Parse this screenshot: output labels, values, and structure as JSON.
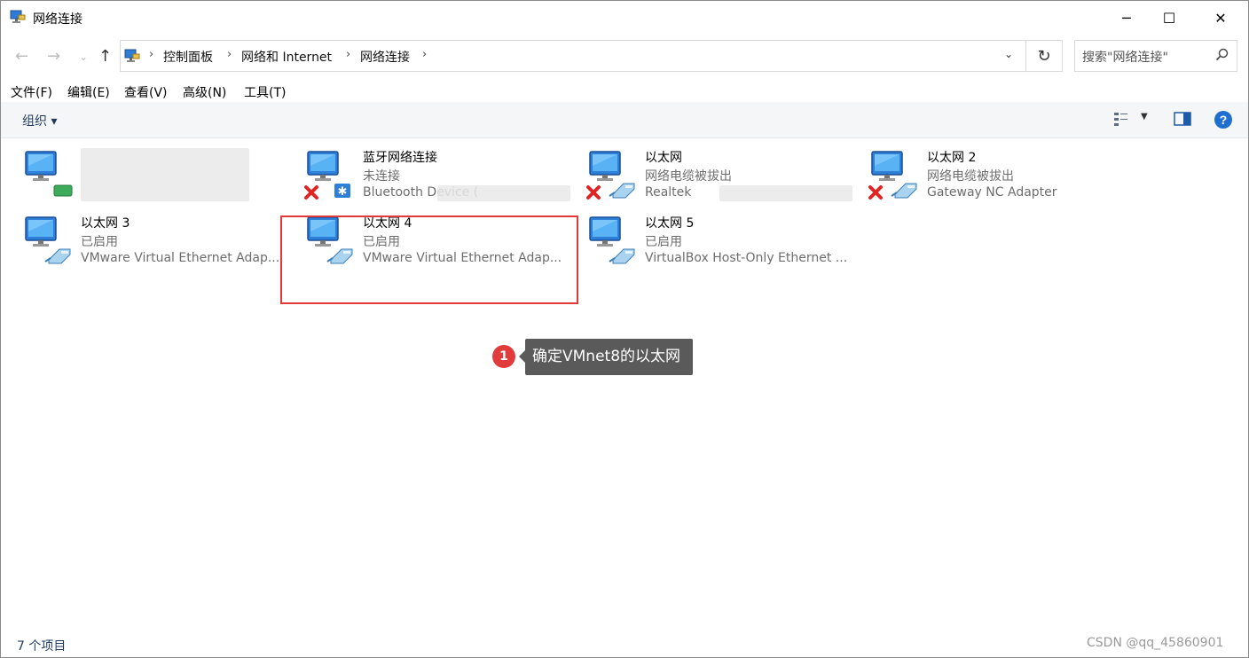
{
  "window": {
    "title": "网络连接"
  },
  "address": {
    "crumbs": [
      "控制面板",
      "网络和 Internet",
      "网络连接"
    ]
  },
  "search": {
    "placeholder": "搜索\"网络连接\""
  },
  "menu": [
    "文件(F)",
    "编辑(E)",
    "查看(V)",
    "高级(N)",
    "工具(T)"
  ],
  "toolbar": {
    "organize_label": "组织 ▾"
  },
  "connections": [
    {
      "name": "",
      "status": "",
      "device": "",
      "obscured": true,
      "disconnected": false,
      "type": "green"
    },
    {
      "name": "蓝牙网络连接",
      "status": "未连接",
      "device": "Bluetooth Device (",
      "obscured": true,
      "disconnected": true,
      "type": "bluetooth"
    },
    {
      "name": "以太网",
      "status": "网络电缆被拔出",
      "device": "Realtek",
      "obscured": true,
      "disconnected": true,
      "type": "ethernet"
    },
    {
      "name": "以太网 2",
      "status": "网络电缆被拔出",
      "device": "Gateway NC Adapter",
      "obscured": false,
      "disconnected": true,
      "type": "ethernet"
    },
    {
      "name": "以太网 3",
      "status": "已启用",
      "device": "VMware Virtual Ethernet Adap...",
      "obscured": false,
      "disconnected": false,
      "type": "ethernet"
    },
    {
      "name": "以太网 4",
      "status": "已启用",
      "device": "VMware Virtual Ethernet Adap...",
      "obscured": false,
      "disconnected": false,
      "type": "ethernet"
    },
    {
      "name": "以太网 5",
      "status": "已启用",
      "device": "VirtualBox Host-Only Ethernet ...",
      "obscured": false,
      "disconnected": false,
      "type": "ethernet"
    }
  ],
  "annotation": {
    "number": "1",
    "text": "确定VMnet8的以太网"
  },
  "statusbar": {
    "count": "7 个项目"
  },
  "watermark": "CSDN @qq_45860901",
  "colors": {
    "highlight": "#e03a3a",
    "callout_bg": "#5a5a5a",
    "badge": "#e23b3b"
  }
}
